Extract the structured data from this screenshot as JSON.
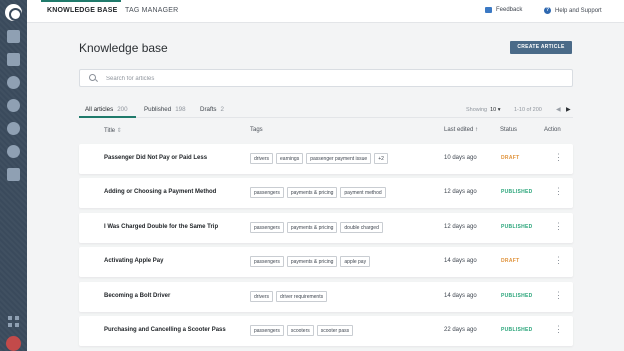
{
  "top_nav": {
    "tabs": [
      {
        "label": "KNOWLEDGE BASE",
        "active": true
      },
      {
        "label": "TAG MANAGER",
        "active": false
      }
    ],
    "feedback_label": "Feedback",
    "help_label": "Help and Support"
  },
  "page": {
    "title": "Knowledge base",
    "create_button": "CREATE ARTICLE"
  },
  "search": {
    "placeholder": "Search for articles",
    "value": ""
  },
  "filters": [
    {
      "label": "All articles",
      "count": "200",
      "active": true
    },
    {
      "label": "Published",
      "count": "198",
      "active": false
    },
    {
      "label": "Drafts",
      "count": "2",
      "active": false
    }
  ],
  "pagination": {
    "showing_label": "Showing",
    "per_page": "10",
    "range": "1-10 of 200"
  },
  "columns": {
    "title": "Title",
    "tags": "Tags",
    "last_edited": "Last edited",
    "status": "Status",
    "action": "Action"
  },
  "colors": {
    "draft": "#e0923a",
    "published": "#2aa57a",
    "accent": "#1f7a6b",
    "button": "#4a6a88"
  },
  "articles": [
    {
      "title": "Passenger Did Not Pay or Paid Less",
      "tags": [
        "drivers",
        "earnings",
        "passenger payment issue",
        "+2"
      ],
      "edited": "10 days ago",
      "status": "DRAFT"
    },
    {
      "title": "Adding or Choosing a Payment Method",
      "tags": [
        "passengers",
        "payments & pricing",
        "payment method"
      ],
      "edited": "12 days ago",
      "status": "PUBLISHED"
    },
    {
      "title": "I Was Charged Double for the Same Trip",
      "tags": [
        "passengers",
        "payments & pricing",
        "double charged"
      ],
      "edited": "12 days ago",
      "status": "PUBLISHED"
    },
    {
      "title": "Activating Apple Pay",
      "tags": [
        "passengers",
        "payments & pricing",
        "apple pay"
      ],
      "edited": "14 days ago",
      "status": "DRAFT"
    },
    {
      "title": "Becoming a Bolt Driver",
      "tags": [
        "drivers",
        "driver requirements"
      ],
      "edited": "14 days ago",
      "status": "PUBLISHED"
    },
    {
      "title": "Purchasing and Cancelling a Scooter Pass",
      "tags": [
        "passengers",
        "scooters",
        "scooter pass"
      ],
      "edited": "22 days ago",
      "status": "PUBLISHED"
    }
  ]
}
